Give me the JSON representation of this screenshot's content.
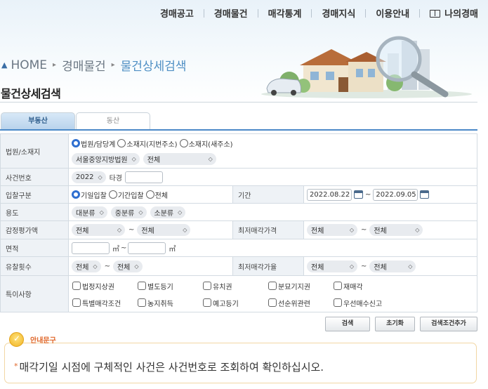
{
  "topnav": {
    "items": [
      "경매공고",
      "경매물건",
      "매각통계",
      "경매지식",
      "이용안내"
    ],
    "mypage": "나의경매",
    "mypage_icon": "book-icon"
  },
  "breadcrumb": {
    "home": "HOME",
    "level1": "경매물건",
    "current": "물건상세검색"
  },
  "page_title": "물건상세검색",
  "tabs": {
    "realestate": "부동산",
    "movables": "동산"
  },
  "form": {
    "court": {
      "label": "법원/소재지",
      "radios": [
        "법원/담당계",
        "소재지(지번주소)",
        "소재지(새주소)"
      ],
      "selected_index": 0,
      "court_select": "서울중앙지방법원",
      "division_select": "전체"
    },
    "case_no": {
      "label": "사건번호",
      "year": "2022",
      "suffix": "타경",
      "value": ""
    },
    "bid_type": {
      "label": "입찰구분",
      "radios": [
        "기일입찰",
        "기간입찰",
        "전체"
      ],
      "selected_index": 0,
      "period_label": "기간",
      "date_from": "2022.08.22",
      "date_to": "2022.09.05",
      "tilde": "~"
    },
    "usage": {
      "label": "용도",
      "large": "대분류",
      "medium": "중분류",
      "small": "소분류"
    },
    "appraisal": {
      "label": "감정평가액",
      "from": "전체",
      "to": "전체",
      "min_price_label": "최저매각가격",
      "min_from": "전체",
      "min_to": "전체"
    },
    "area": {
      "label": "면적",
      "unit": "㎡",
      "from": "",
      "to": ""
    },
    "fail_count": {
      "label": "유찰횟수",
      "from": "전체",
      "to": "전체",
      "min_rate_label": "최저매각가율",
      "rate_from": "전체",
      "rate_to": "전체"
    },
    "special": {
      "label": "특이사항",
      "options": [
        "법정지상권",
        "별도등기",
        "유치권",
        "분묘기지권",
        "재매각",
        "특별매각조건",
        "농지취득",
        "예고등기",
        "선순위관련",
        "우선매수신고"
      ]
    }
  },
  "buttons": {
    "search": "검색",
    "reset": "초기화",
    "add_condition": "검색조건추가"
  },
  "notice": {
    "title": "안내문구",
    "text": "매각기일 시점에 구체적인 사건은 사건번호로 조회하여 확인하십시오."
  },
  "colors": {
    "accent": "#4b89c8",
    "notice_accent": "#e0672a",
    "label_bg": "#eef2f6"
  }
}
